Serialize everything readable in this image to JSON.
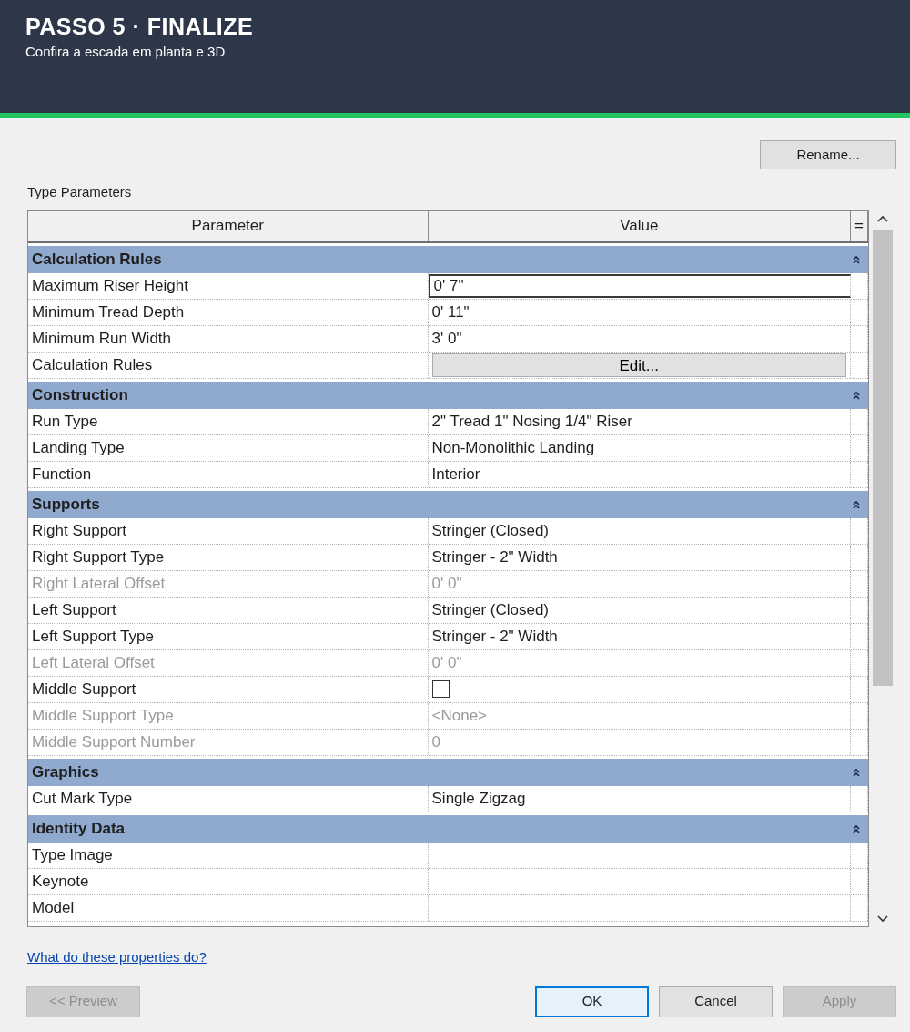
{
  "banner": {
    "title": "PASSO 5 · FINALIZE",
    "subtitle": "Confira a escada em planta e 3D"
  },
  "dialog": {
    "side_buttons": [
      "Rename..."
    ]
  },
  "section_label": "Type Parameters",
  "table": {
    "columns": [
      "Parameter",
      "Value",
      "="
    ],
    "groups": [
      {
        "title": "Calculation Rules",
        "expanded": true,
        "rows": [
          {
            "kind": "text",
            "name": "Maximum Riser Height",
            "value": "0'  7\"",
            "disabled": false,
            "focused": true
          },
          {
            "kind": "text",
            "name": "Minimum Tread Depth",
            "value": "0'  11\"",
            "disabled": false,
            "focused": false
          },
          {
            "kind": "text",
            "name": "Minimum Run Width",
            "value": "3'  0\"",
            "disabled": false,
            "focused": false
          },
          {
            "kind": "button",
            "name": "Calculation Rules",
            "value": "Edit...",
            "disabled": false,
            "focused": false
          }
        ]
      },
      {
        "title": "Construction",
        "expanded": true,
        "rows": [
          {
            "kind": "text",
            "name": "Run Type",
            "value": "2\" Tread 1\" Nosing 1/4\" Riser",
            "disabled": false,
            "focused": false
          },
          {
            "kind": "text",
            "name": "Landing Type",
            "value": "Non-Monolithic Landing",
            "disabled": false,
            "focused": false
          },
          {
            "kind": "text",
            "name": "Function",
            "value": "Interior",
            "disabled": false,
            "focused": false
          }
        ]
      },
      {
        "title": "Supports",
        "expanded": true,
        "rows": [
          {
            "kind": "text",
            "name": "Right Support",
            "value": "Stringer (Closed)",
            "disabled": false,
            "focused": false
          },
          {
            "kind": "text",
            "name": "Right Support Type",
            "value": "Stringer - 2\" Width",
            "disabled": false,
            "focused": false
          },
          {
            "kind": "text",
            "name": "Right Lateral Offset",
            "value": "0'  0\"",
            "disabled": true,
            "focused": false
          },
          {
            "kind": "text",
            "name": "Left Support",
            "value": "Stringer (Closed)",
            "disabled": false,
            "focused": false
          },
          {
            "kind": "text",
            "name": "Left Support Type",
            "value": "Stringer - 2\" Width",
            "disabled": false,
            "focused": false
          },
          {
            "kind": "text",
            "name": "Left Lateral Offset",
            "value": "0'  0\"",
            "disabled": true,
            "focused": false
          },
          {
            "kind": "checkbox",
            "name": "Middle Support",
            "checked": false,
            "disabled": false,
            "focused": false
          },
          {
            "kind": "text",
            "name": "Middle Support Type",
            "value": "<None>",
            "disabled": true,
            "focused": false
          },
          {
            "kind": "text",
            "name": "Middle Support Number",
            "value": "0",
            "disabled": true,
            "focused": false
          }
        ]
      },
      {
        "title": "Graphics",
        "expanded": true,
        "rows": [
          {
            "kind": "text",
            "name": "Cut Mark Type",
            "value": "Single Zigzag",
            "disabled": false,
            "focused": false
          }
        ]
      },
      {
        "title": "Identity Data",
        "expanded": true,
        "rows": [
          {
            "kind": "text",
            "name": "Type Image",
            "value": "",
            "disabled": false,
            "focused": false
          },
          {
            "kind": "text",
            "name": "Keynote",
            "value": "",
            "disabled": false,
            "focused": false
          },
          {
            "kind": "text",
            "name": "Model",
            "value": "",
            "disabled": false,
            "focused": false
          }
        ]
      }
    ]
  },
  "help_link": "What do these properties do?",
  "buttons": [
    {
      "label": "<< Preview",
      "disabled": true,
      "selected": false
    },
    {
      "label": "OK",
      "disabled": false,
      "selected": true
    },
    {
      "label": "Cancel",
      "disabled": false,
      "selected": false
    },
    {
      "label": "Apply",
      "disabled": true,
      "selected": false
    }
  ]
}
